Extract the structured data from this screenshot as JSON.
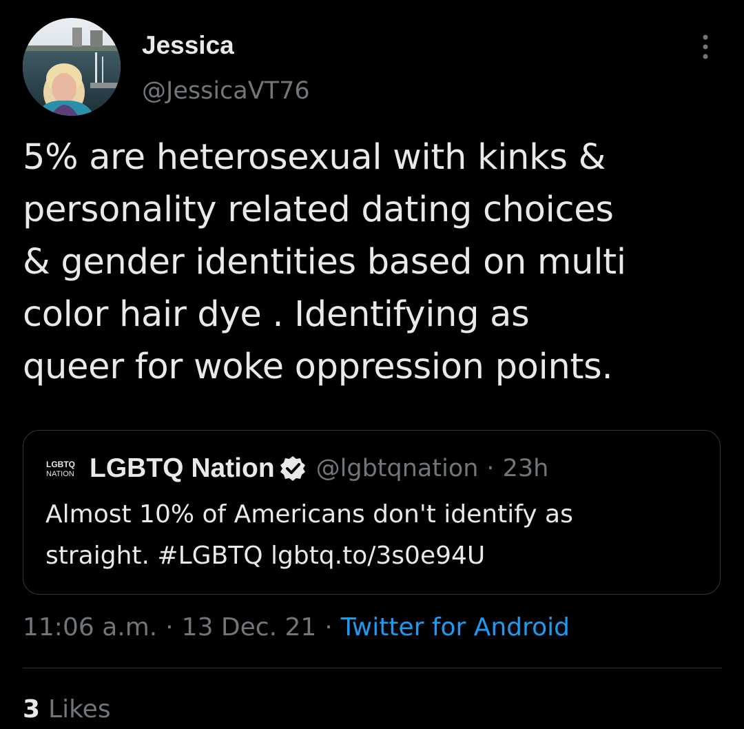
{
  "author": {
    "display_name": "Jessica",
    "handle": "@JessicaVT76",
    "avatar_icon": "profile-photo"
  },
  "more_icon": "more-vertical-icon",
  "tweet": {
    "text": "5% are heterosexual with kinks &\npersonality related dating choices\n& gender identities based on multi\ncolor hair dye . Identifying as\nqueer for woke oppression points."
  },
  "quoted_tweet": {
    "logo_text_line1": "LGBTQ",
    "logo_text_line2": "NATION",
    "name": "LGBTQ Nation",
    "handle": "@lgbtqnation",
    "separator": "·",
    "time": "23h",
    "text": "Almost 10% of Americans don't identify as\nstraight. #LGBTQ lgbtq.to/3s0e94U",
    "verified_icon": "verified-badge-icon"
  },
  "meta": {
    "time": "11:06 a.m.",
    "separator": "·",
    "date": "13 Dec. 21",
    "source": "Twitter for Android"
  },
  "engagement": {
    "likes_count": "3",
    "likes_label": "Likes"
  },
  "colors": {
    "background": "#000000",
    "text_primary": "#e7e9ea",
    "text_secondary": "#71767b",
    "accent": "#1d9bf0",
    "border": "#333639"
  }
}
